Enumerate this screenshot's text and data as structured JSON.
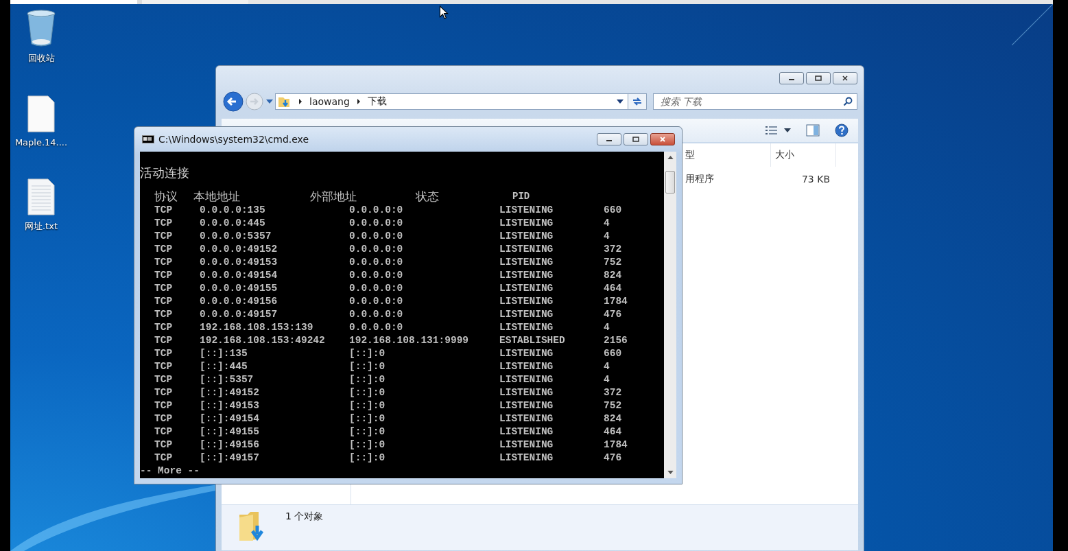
{
  "desktop_icons": [
    {
      "kind": "recycle",
      "label": "回收站"
    },
    {
      "kind": "blank",
      "label": "Maple.14...."
    },
    {
      "kind": "text",
      "label": "网址.txt"
    }
  ],
  "explorer": {
    "address": [
      "laowang",
      "下载"
    ],
    "search": {
      "placeholder": "搜索 下载"
    },
    "columns": [
      "型",
      "大小"
    ],
    "rows": [
      {
        "column_1": "用程序",
        "size": "73 KB"
      }
    ],
    "status_bar": "1 个对象"
  },
  "cmd": {
    "title": "C:\\Windows\\system32\\cmd.exe",
    "heading": "活动连接",
    "header": [
      "协议",
      "本地地址",
      "外部地址",
      "状态",
      "PID"
    ],
    "rows": [
      [
        "TCP",
        "0.0.0.0:135",
        "0.0.0.0:0",
        "LISTENING",
        "660"
      ],
      [
        "TCP",
        "0.0.0.0:445",
        "0.0.0.0:0",
        "LISTENING",
        "4"
      ],
      [
        "TCP",
        "0.0.0.0:5357",
        "0.0.0.0:0",
        "LISTENING",
        "4"
      ],
      [
        "TCP",
        "0.0.0.0:49152",
        "0.0.0.0:0",
        "LISTENING",
        "372"
      ],
      [
        "TCP",
        "0.0.0.0:49153",
        "0.0.0.0:0",
        "LISTENING",
        "752"
      ],
      [
        "TCP",
        "0.0.0.0:49154",
        "0.0.0.0:0",
        "LISTENING",
        "824"
      ],
      [
        "TCP",
        "0.0.0.0:49155",
        "0.0.0.0:0",
        "LISTENING",
        "464"
      ],
      [
        "TCP",
        "0.0.0.0:49156",
        "0.0.0.0:0",
        "LISTENING",
        "1784"
      ],
      [
        "TCP",
        "0.0.0.0:49157",
        "0.0.0.0:0",
        "LISTENING",
        "476"
      ],
      [
        "TCP",
        "192.168.108.153:139",
        "0.0.0.0:0",
        "LISTENING",
        "4"
      ],
      [
        "TCP",
        "192.168.108.153:49242",
        "192.168.108.131:9999",
        "ESTABLISHED",
        "2156"
      ],
      [
        "TCP",
        "[::]:135",
        "[::]:0",
        "LISTENING",
        "660"
      ],
      [
        "TCP",
        "[::]:445",
        "[::]:0",
        "LISTENING",
        "4"
      ],
      [
        "TCP",
        "[::]:5357",
        "[::]:0",
        "LISTENING",
        "4"
      ],
      [
        "TCP",
        "[::]:49152",
        "[::]:0",
        "LISTENING",
        "372"
      ],
      [
        "TCP",
        "[::]:49153",
        "[::]:0",
        "LISTENING",
        "752"
      ],
      [
        "TCP",
        "[::]:49154",
        "[::]:0",
        "LISTENING",
        "824"
      ],
      [
        "TCP",
        "[::]:49155",
        "[::]:0",
        "LISTENING",
        "464"
      ],
      [
        "TCP",
        "[::]:49156",
        "[::]:0",
        "LISTENING",
        "1784"
      ],
      [
        "TCP",
        "[::]:49157",
        "[::]:0",
        "LISTENING",
        "476"
      ]
    ],
    "pager": "-- More --"
  }
}
